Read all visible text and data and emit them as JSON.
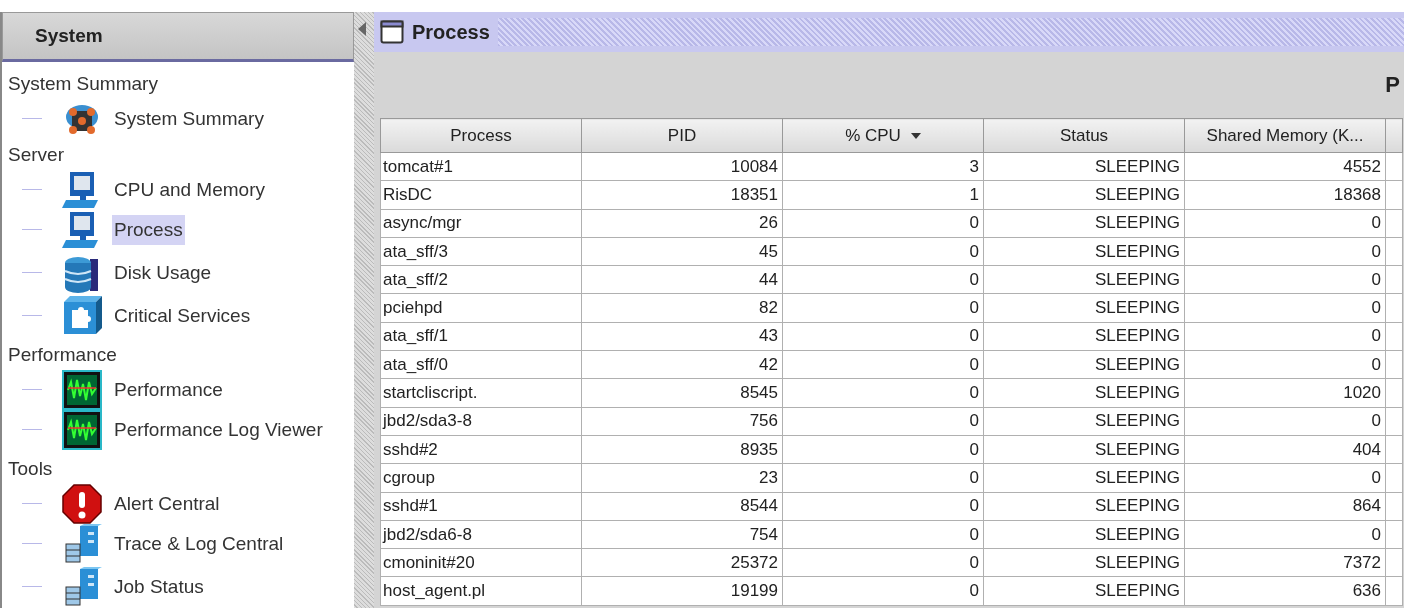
{
  "sidebar": {
    "title": "System",
    "tree": [
      {
        "label": "System Summary",
        "children": [
          {
            "label": "System Summary",
            "kind": "summary",
            "selected": false
          }
        ]
      },
      {
        "label": "Server",
        "children": [
          {
            "label": "CPU and Memory",
            "kind": "server",
            "selected": false
          },
          {
            "label": "Process",
            "kind": "server",
            "selected": true
          },
          {
            "label": "Disk Usage",
            "kind": "database",
            "selected": false
          },
          {
            "label": "Critical Services",
            "kind": "services",
            "selected": false
          }
        ]
      },
      {
        "label": "Performance",
        "children": [
          {
            "label": "Performance",
            "kind": "monitor",
            "selected": false
          },
          {
            "label": "Performance Log Viewer",
            "kind": "monitor",
            "selected": false
          }
        ]
      },
      {
        "label": "Tools",
        "children": [
          {
            "label": "Alert Central",
            "kind": "alert",
            "selected": false
          },
          {
            "label": "Trace & Log Central",
            "kind": "trace",
            "selected": false
          },
          {
            "label": "Job Status",
            "kind": "trace",
            "selected": false
          }
        ]
      }
    ]
  },
  "panel": {
    "title": "Process",
    "heading": "P"
  },
  "table": {
    "columns": [
      {
        "label": "Process",
        "sorted": false
      },
      {
        "label": "PID",
        "sorted": false
      },
      {
        "label": "% CPU",
        "sorted": true
      },
      {
        "label": "Status",
        "sorted": false
      },
      {
        "label": "Shared Memory (K...",
        "sorted": false
      }
    ],
    "rows": [
      [
        "tomcat#1",
        "10084",
        "3",
        "SLEEPING",
        "4552"
      ],
      [
        "RisDC",
        "18351",
        "1",
        "SLEEPING",
        "18368"
      ],
      [
        "async/mgr",
        "26",
        "0",
        "SLEEPING",
        "0"
      ],
      [
        "ata_sff/3",
        "45",
        "0",
        "SLEEPING",
        "0"
      ],
      [
        "ata_sff/2",
        "44",
        "0",
        "SLEEPING",
        "0"
      ],
      [
        "pciehpd",
        "82",
        "0",
        "SLEEPING",
        "0"
      ],
      [
        "ata_sff/1",
        "43",
        "0",
        "SLEEPING",
        "0"
      ],
      [
        "ata_sff/0",
        "42",
        "0",
        "SLEEPING",
        "0"
      ],
      [
        "startcliscript.",
        "8545",
        "0",
        "SLEEPING",
        "1020"
      ],
      [
        "jbd2/sda3-8",
        "756",
        "0",
        "SLEEPING",
        "0"
      ],
      [
        "sshd#2",
        "8935",
        "0",
        "SLEEPING",
        "404"
      ],
      [
        "cgroup",
        "23",
        "0",
        "SLEEPING",
        "0"
      ],
      [
        "sshd#1",
        "8544",
        "0",
        "SLEEPING",
        "864"
      ],
      [
        "jbd2/sda6-8",
        "754",
        "0",
        "SLEEPING",
        "0"
      ],
      [
        "cmoninit#20",
        "25372",
        "0",
        "SLEEPING",
        "7372"
      ],
      [
        "host_agent.pl",
        "19199",
        "0",
        "SLEEPING",
        "636"
      ]
    ]
  }
}
